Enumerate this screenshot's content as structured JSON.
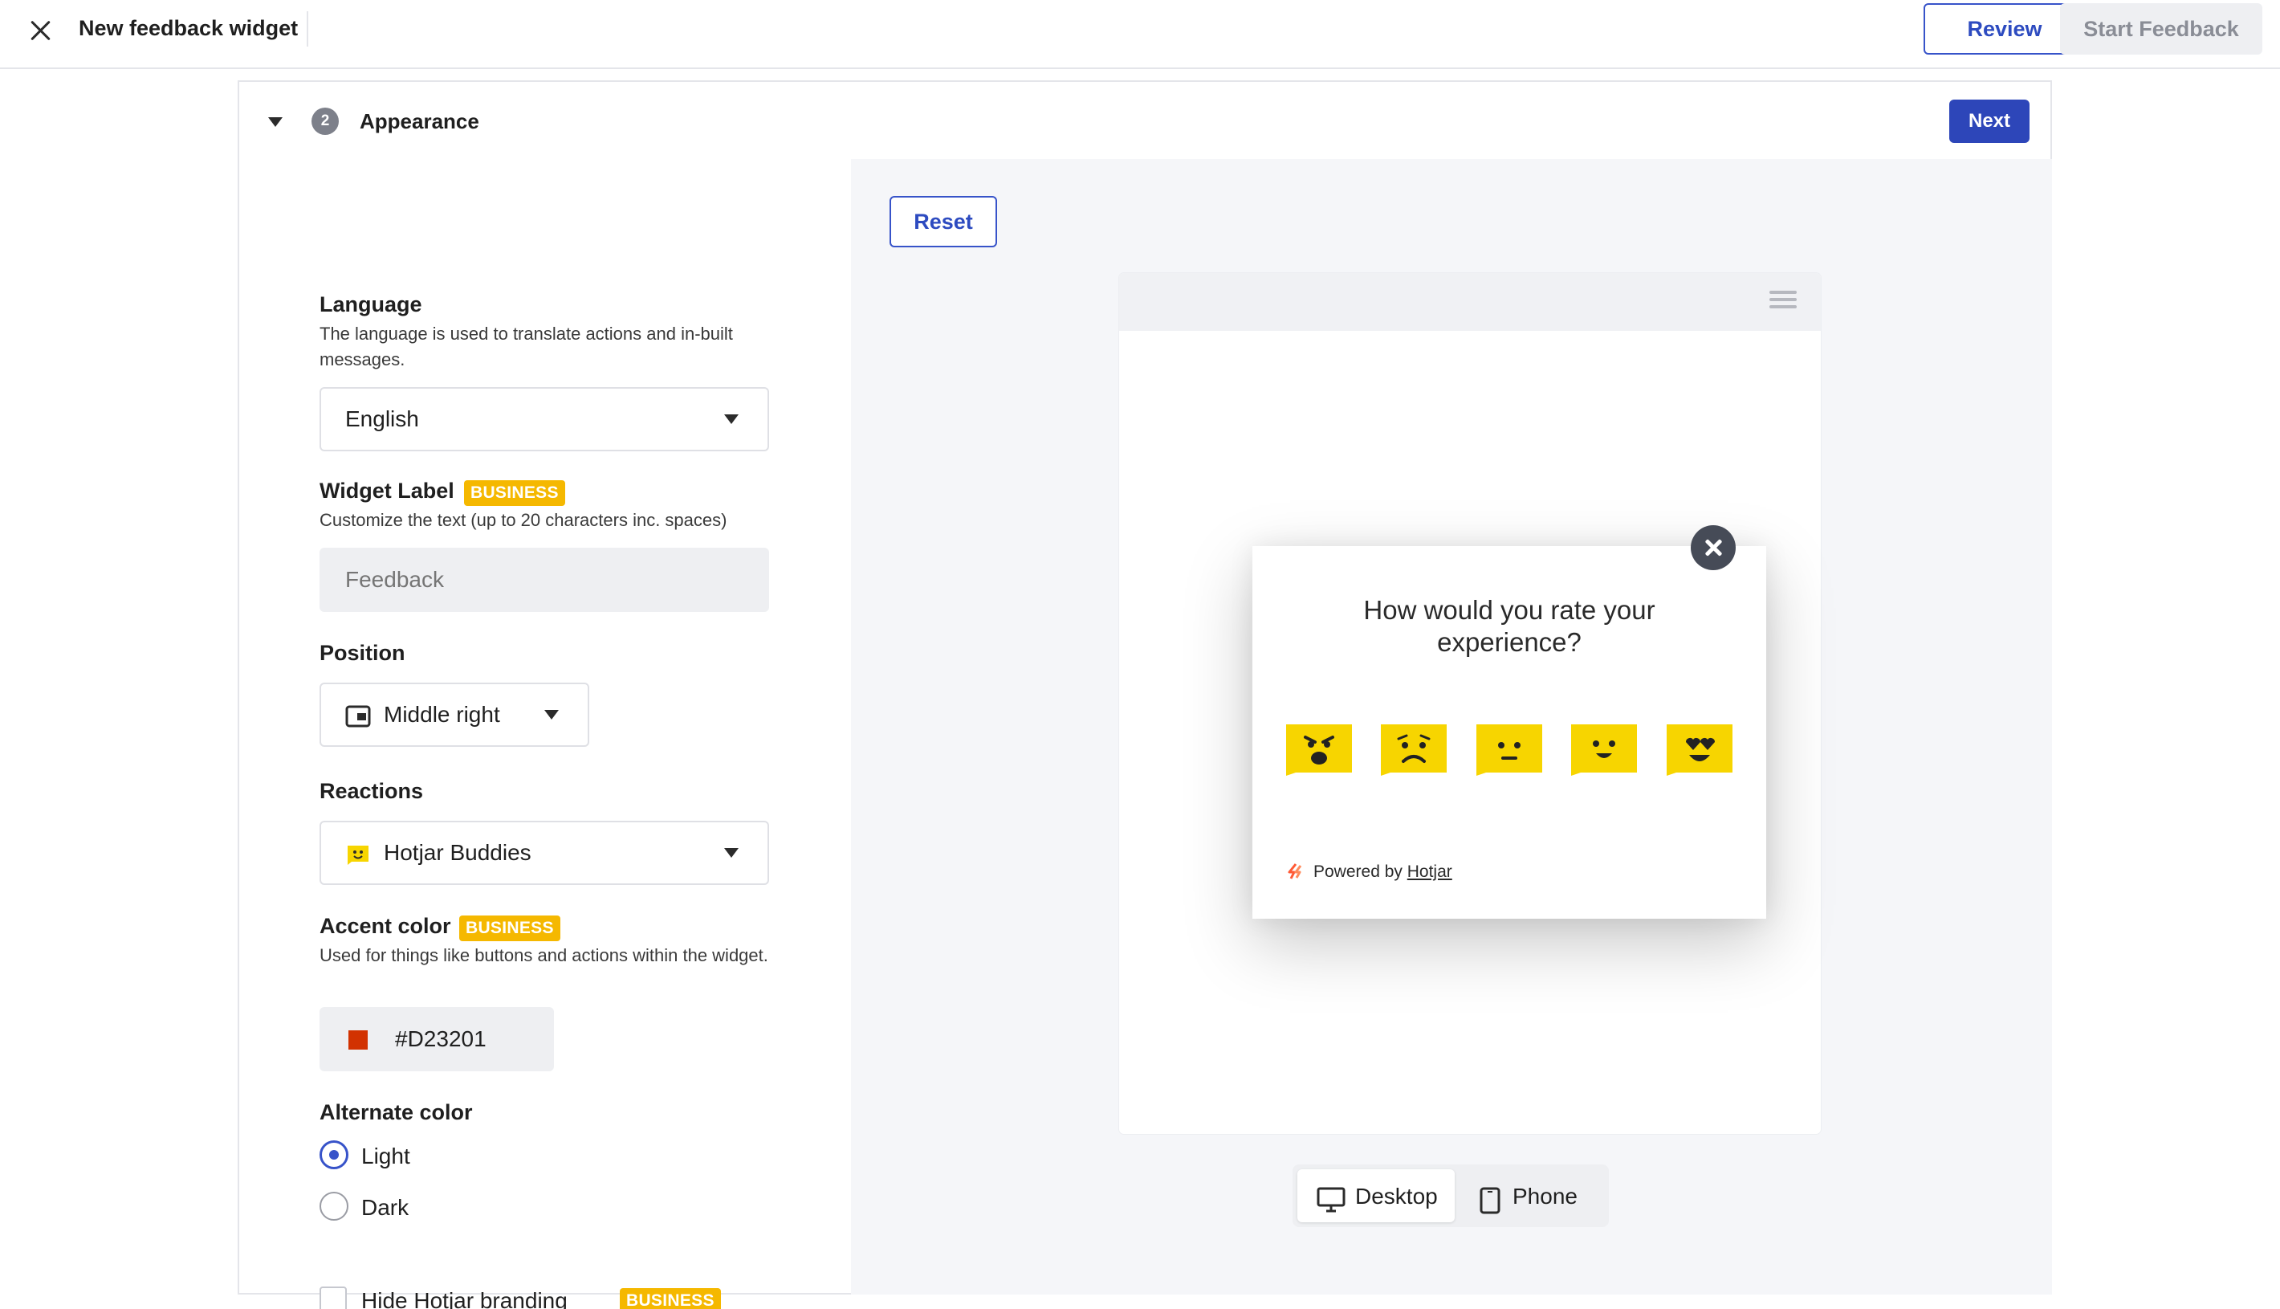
{
  "topbar": {
    "title": "New feedback widget",
    "review_label": "Review",
    "start_label": "Start Feedback"
  },
  "step": {
    "number": "2",
    "title": "Appearance",
    "next_label": "Next"
  },
  "language": {
    "label": "Language",
    "help": "The language is used to translate actions and in-built messages.",
    "value": "English"
  },
  "widget_label": {
    "label": "Widget Label",
    "badge": "BUSINESS",
    "help": "Customize the text (up to 20 characters inc. spaces)",
    "placeholder": "Feedback"
  },
  "position": {
    "label": "Position",
    "value": "Middle right",
    "icon": "widget-position-icon"
  },
  "reactions": {
    "label": "Reactions",
    "value": "Hotjar Buddies",
    "icon": "hotjar-buddy-icon"
  },
  "accent": {
    "label": "Accent color",
    "badge": "BUSINESS",
    "help": "Used for things like buttons and actions within the widget.",
    "value": "#D23201",
    "swatch_color": "#D23201"
  },
  "alternate": {
    "label": "Alternate color",
    "options": [
      {
        "label": "Light",
        "checked": true
      },
      {
        "label": "Dark",
        "checked": false
      }
    ]
  },
  "branding": {
    "label": "Hide Hotjar branding",
    "badge": "BUSINESS",
    "checked": false
  },
  "preview": {
    "reset_label": "Reset",
    "question": "How would you rate your experience?",
    "reactions": [
      "hate-icon",
      "dislike-icon",
      "neutral-icon",
      "like-icon",
      "love-icon"
    ],
    "powered_prefix": "Powered by",
    "powered_link": "Hotjar",
    "devices": [
      {
        "label": "Desktop",
        "icon": "desktop-icon",
        "active": true
      },
      {
        "label": "Phone",
        "icon": "phone-icon",
        "active": false
      }
    ]
  },
  "colors": {
    "primary": "#2d46b9",
    "badge": "#f5b800",
    "emoji": "#f7d500",
    "close_button": "#464b57"
  }
}
